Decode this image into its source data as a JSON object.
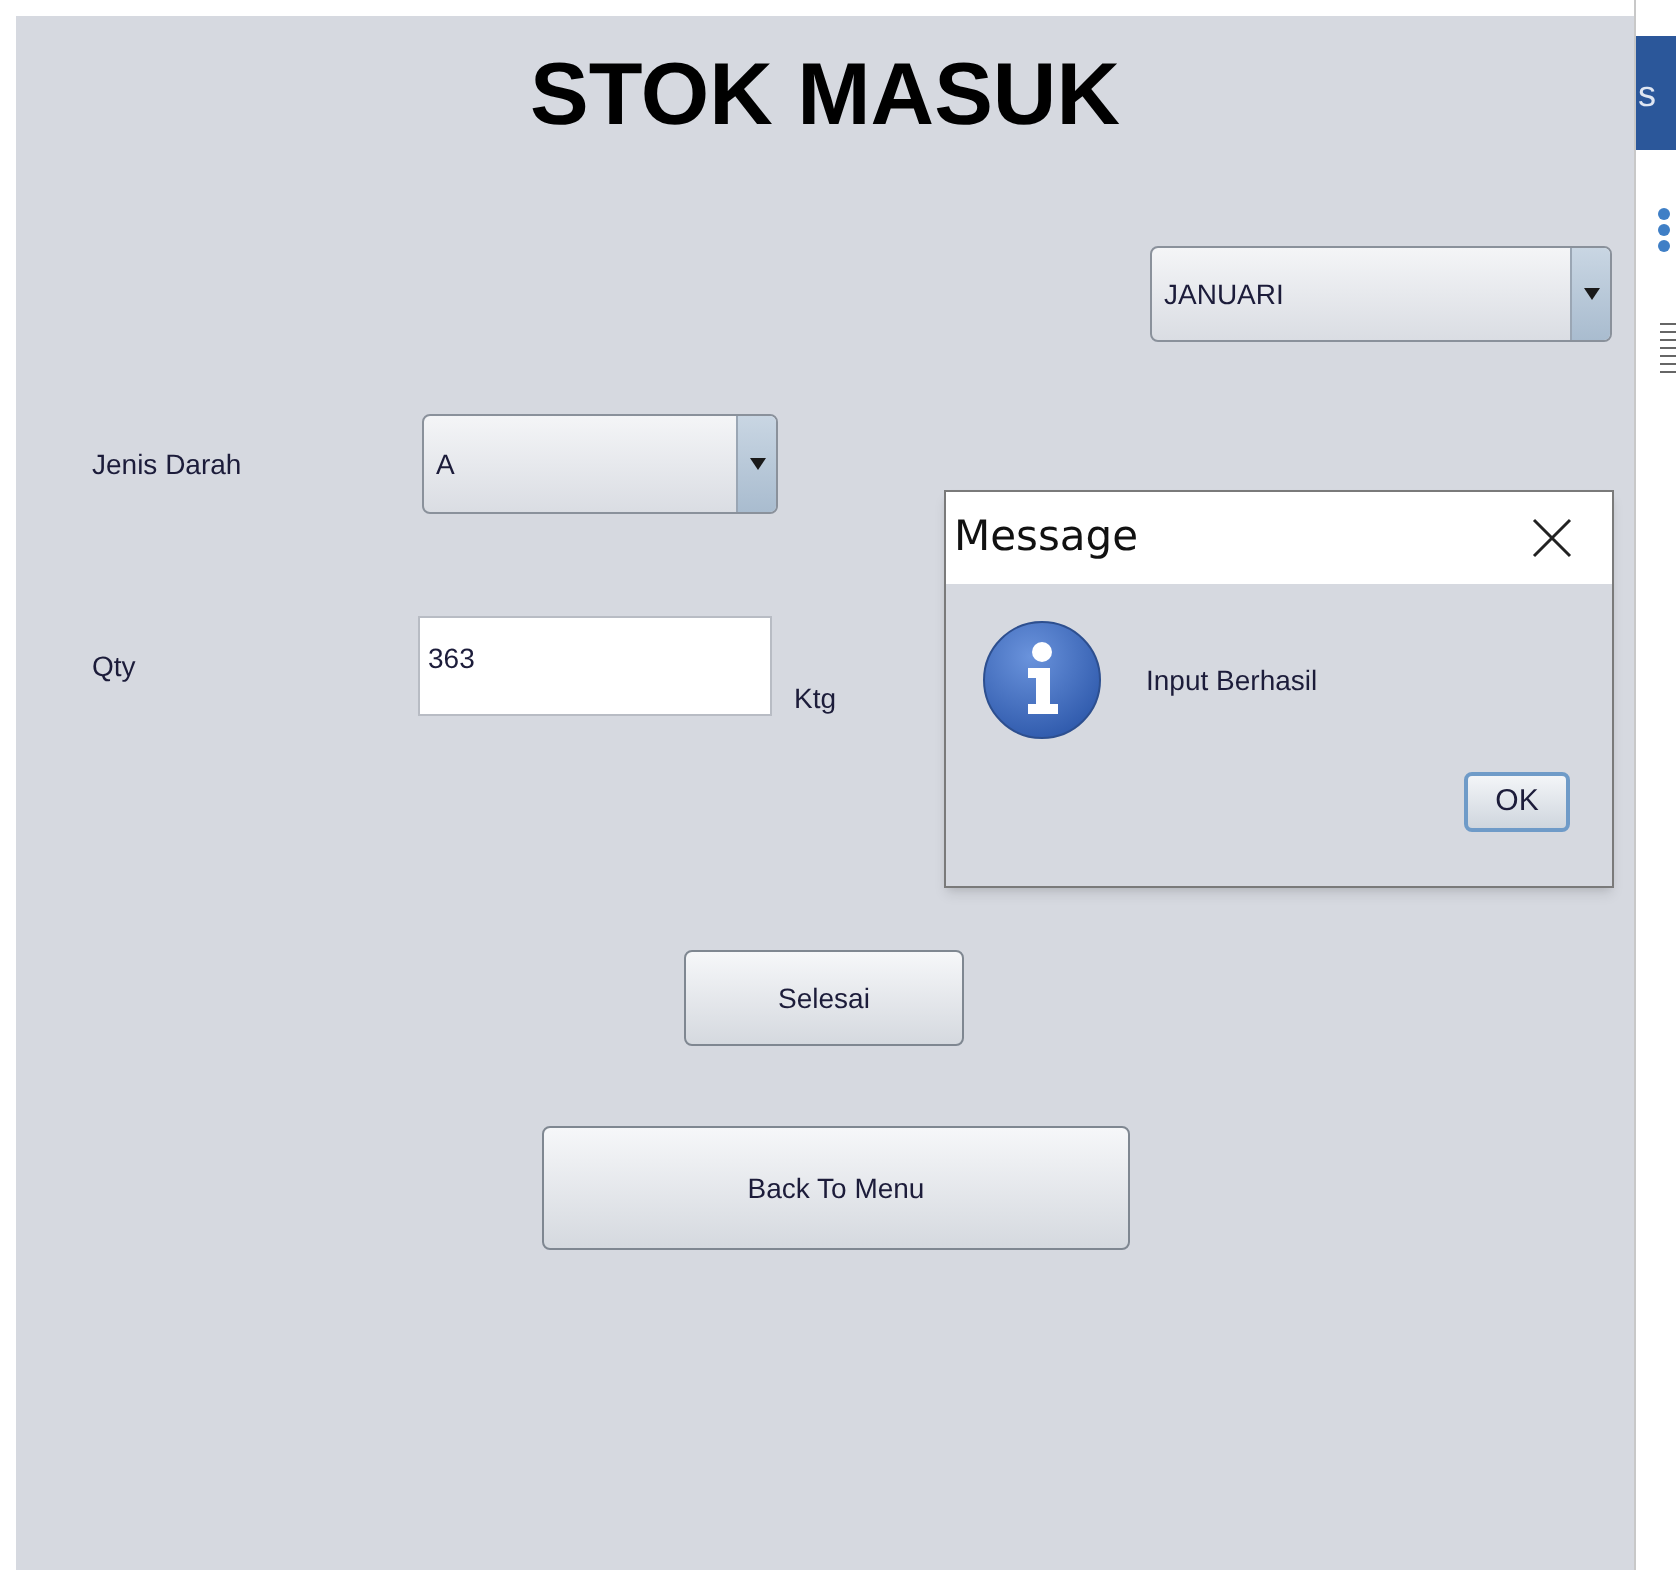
{
  "title": "STOK MASUK",
  "month_combo": {
    "value": "JANUARI"
  },
  "fields": [
    {
      "kind": "combo",
      "label": "Jenis Darah",
      "value": "A"
    },
    {
      "kind": "text",
      "label": "Qty",
      "value": "363",
      "unit": "Ktg"
    }
  ],
  "buttons": [
    "Selesai",
    "Back To Menu"
  ],
  "dialog": {
    "title": "Message",
    "message": "Input Berhasil",
    "button": "OK"
  },
  "background_window": {
    "header_text": "s"
  }
}
